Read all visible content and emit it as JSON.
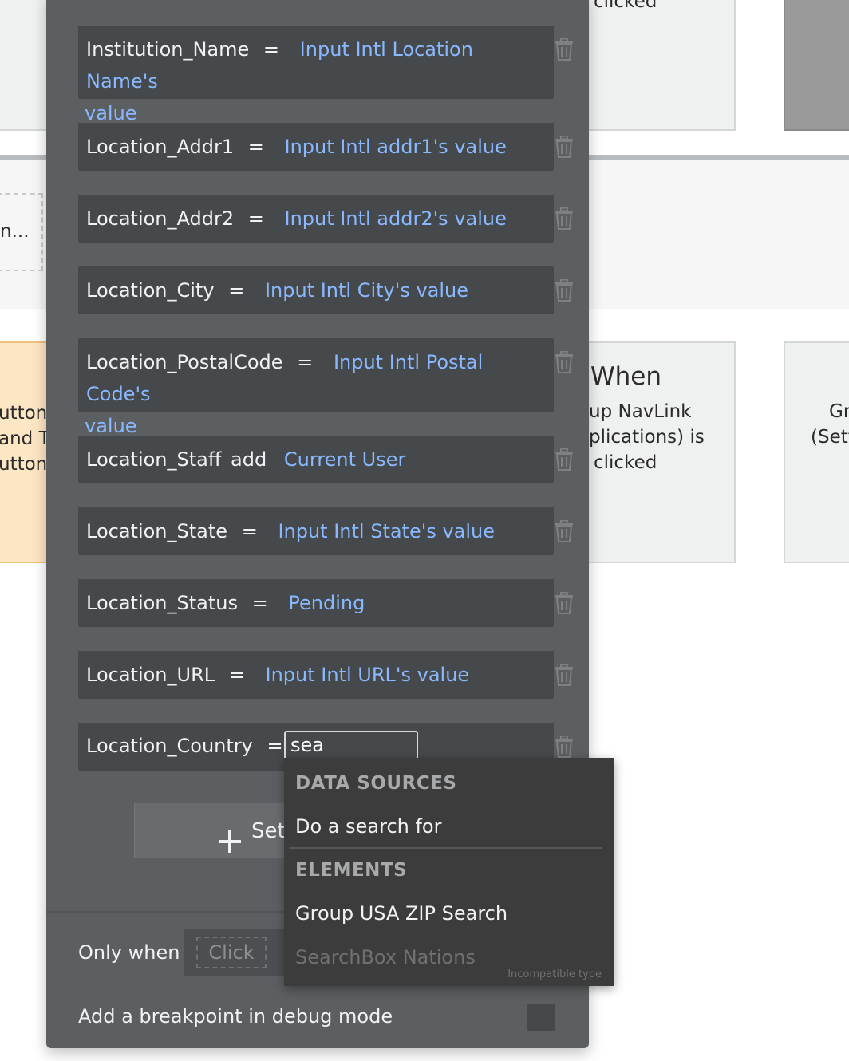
{
  "background": {
    "top_card_fragment": "clicked",
    "mid_left_fragment": "n...",
    "left_card_lines": [
      "utton",
      " and T",
      "utton"
    ],
    "when_card": {
      "title": "When",
      "lines": [
        "up NavLink",
        "plications) is",
        "clicked"
      ]
    },
    "right_card_lines": [
      "Gr",
      "(Sett"
    ]
  },
  "panel": {
    "rows": [
      {
        "field": "Institution_Name",
        "operator": "=",
        "value": "Input Intl Location Name's",
        "value_wrap": "value"
      },
      {
        "field": "Location_Addr1",
        "operator": "=",
        "value": "Input Intl addr1's value"
      },
      {
        "field": "Location_Addr2",
        "operator": "=",
        "value": "Input Intl addr2's value"
      },
      {
        "field": "Location_City",
        "operator": "=",
        "value": "Input Intl City's value"
      },
      {
        "field": "Location_PostalCode",
        "operator": "=",
        "value": "Input Intl Postal Code's",
        "value_wrap": "value"
      },
      {
        "field": "Location_Staff",
        "operator": "add",
        "value": "Current User"
      },
      {
        "field": "Location_State",
        "operator": "=",
        "value": "Input Intl State's value"
      },
      {
        "field": "Location_Status",
        "operator": "=",
        "value": "Pending"
      },
      {
        "field": "Location_URL",
        "operator": "=",
        "value": "Input Intl URL's value"
      },
      {
        "field": "Location_Country",
        "operator": "=",
        "input_value": "sea"
      }
    ],
    "add_button_label": "Set",
    "only_when_label": "Only when",
    "condition_placeholder": "Click",
    "breakpoint_label": "Add a breakpoint in debug mode"
  },
  "dropdown": {
    "section_data_sources": "DATA SOURCES",
    "item_search": "Do a search for",
    "section_elements": "ELEMENTS",
    "item_group_zip": "Group USA ZIP Search",
    "item_searchbox": "SearchBox Nations",
    "incompatible_note": "Incompatible type"
  },
  "icons": {
    "delete": "trash-icon",
    "add": "plus-icon"
  }
}
